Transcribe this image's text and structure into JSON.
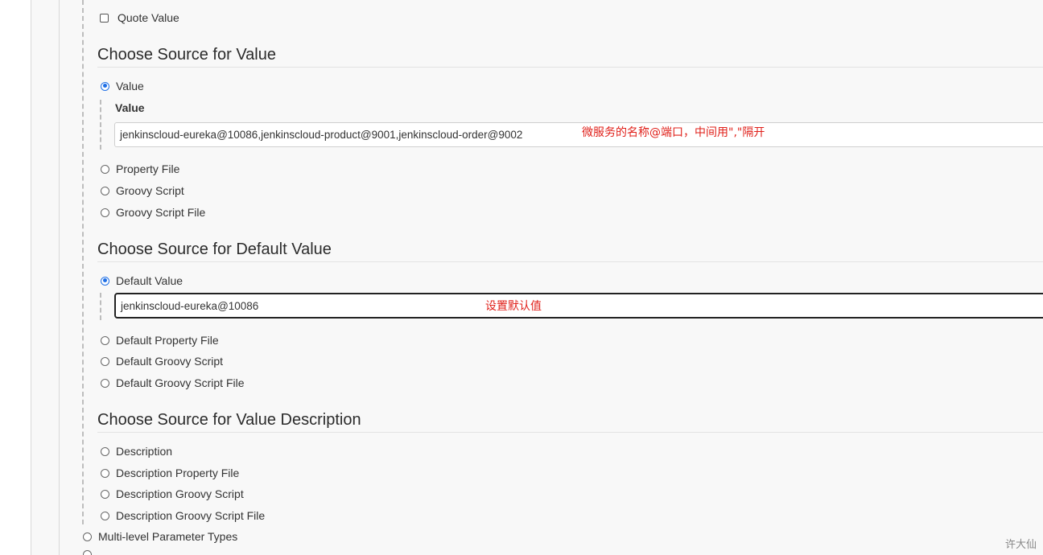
{
  "quote_value": {
    "label": "Quote Value",
    "checked": false
  },
  "value_source": {
    "heading": "Choose Source for Value",
    "options": [
      "Value",
      "Property File",
      "Groovy Script",
      "Groovy Script File"
    ],
    "selected": "Value",
    "field_label": "Value",
    "field_value": "jenkinscloud-eureka@10086,jenkinscloud-product@9001,jenkinscloud-order@9002",
    "annotation": "微服务的名称@端口，中间用\",\"隔开"
  },
  "default_source": {
    "heading": "Choose Source for Default Value",
    "options": [
      "Default Value",
      "Default Property File",
      "Default Groovy Script",
      "Default Groovy Script File"
    ],
    "selected": "Default Value",
    "field_value": "jenkinscloud-eureka@10086",
    "annotation": "设置默认值"
  },
  "description_source": {
    "heading": "Choose Source for Value Description",
    "options": [
      "Description",
      "Description Property File",
      "Description Groovy Script",
      "Description Groovy Script File"
    ]
  },
  "parameter_types": {
    "options": [
      "Multi-level Parameter Types"
    ]
  },
  "watermark": "许大仙",
  "colors": {
    "accent": "#1f6fe5",
    "annotation": "#e0201a",
    "panel": "#f8f8f8"
  }
}
